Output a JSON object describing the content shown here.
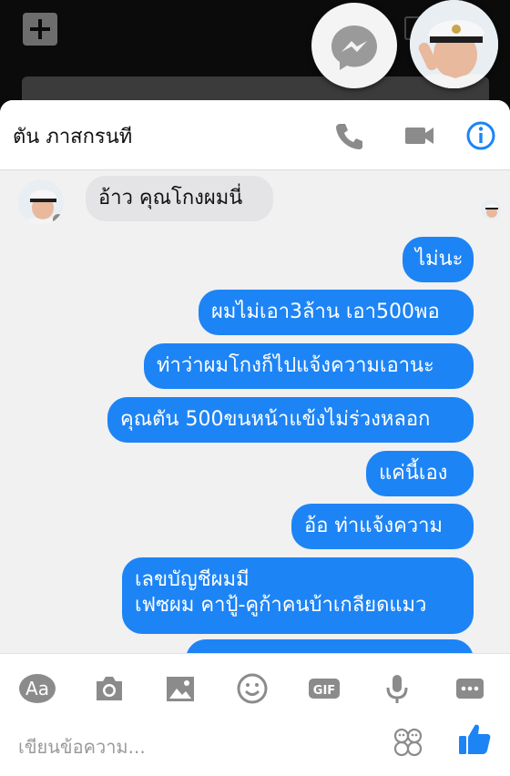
{
  "contact": {
    "name": "ตัน ภาสกรนที"
  },
  "header_icons": [
    "phone-icon",
    "video-call-icon",
    "info-icon"
  ],
  "messages": [
    {
      "direction": "incoming",
      "text": "อ้าว คุณโกงผมนี่"
    },
    {
      "direction": "outgoing",
      "text": "ไม่นะ"
    },
    {
      "direction": "outgoing",
      "text": "ผมไม่เอา3ล้าน เอา500พอ"
    },
    {
      "direction": "outgoing",
      "text": "ท่าว่าผมโกงก็ไปแจ้งความเอานะ"
    },
    {
      "direction": "outgoing",
      "text": "คุณตัน 500ขนหน้าแข้งไม่ร่วงหลอก"
    },
    {
      "direction": "outgoing",
      "text": "แค่นี้เอง"
    },
    {
      "direction": "outgoing",
      "text": "อ้อ ท่าแจ้งความ"
    },
    {
      "direction": "outgoing",
      "lines": [
        "เลขบัญชีผมมี",
        "เฟซผม คาปู้-คูก้าคนบ้าเกลียดแมว"
      ]
    }
  ],
  "toolbar": {
    "aa_label": "Aa",
    "gif_label": "GIF",
    "items": [
      "aa-button",
      "camera-icon",
      "gallery-icon",
      "emoji-icon",
      "gif-button",
      "microphone-icon",
      "more-icon"
    ]
  },
  "composer": {
    "placeholder": "เขียนข้อความ..."
  },
  "colors": {
    "accent": "#1d84f5",
    "incoming_bubble": "#e4e4e6",
    "icon_gray": "#8b8b8b"
  }
}
